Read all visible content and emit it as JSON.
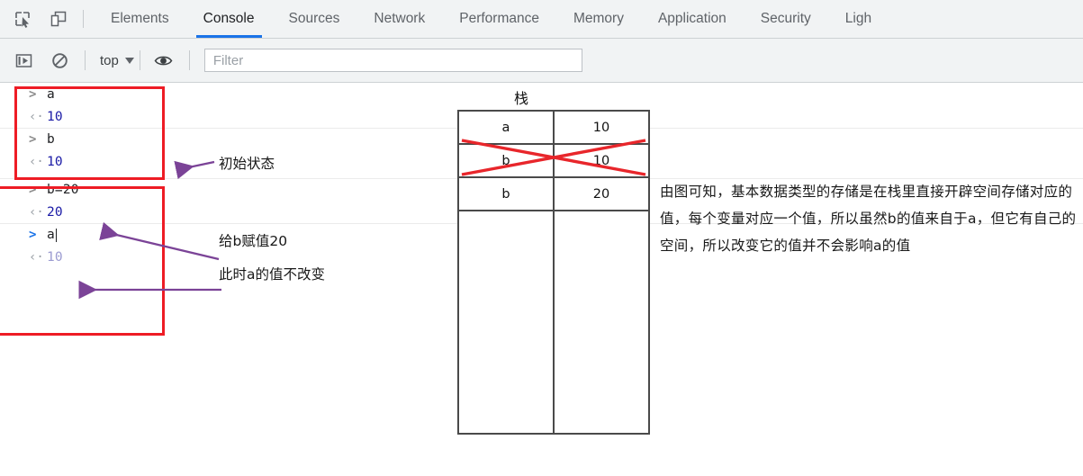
{
  "devtools": {
    "icons": [
      {
        "name": "inspect-element-icon",
        "label": "Inspect element"
      },
      {
        "name": "device-toolbar-icon",
        "label": "Toggle device toolbar"
      }
    ],
    "tabs": [
      {
        "label": "Elements",
        "active": false
      },
      {
        "label": "Console",
        "active": true
      },
      {
        "label": "Sources",
        "active": false
      },
      {
        "label": "Network",
        "active": false
      },
      {
        "label": "Performance",
        "active": false
      },
      {
        "label": "Memory",
        "active": false
      },
      {
        "label": "Application",
        "active": false
      },
      {
        "label": "Security",
        "active": false
      },
      {
        "label": "Ligh",
        "active": false
      }
    ],
    "active_tab": "Console",
    "accent_color": "#1a73e8",
    "toolbar_bg": "#f1f3f4"
  },
  "console_toolbar": {
    "execute_icon": "execute-step-icon",
    "clear_icon": "clear-console-icon",
    "context_label": "top",
    "context_caret": "caret-down-icon",
    "eye_icon": "live-expression-eye-icon",
    "filter_placeholder": "Filter"
  },
  "console": {
    "input_marker": ">",
    "output_marker": "‹·",
    "rows": [
      {
        "type": "input",
        "text": "a",
        "active": false
      },
      {
        "type": "output",
        "text": "10",
        "faded": false
      },
      {
        "type": "input",
        "text": "b",
        "active": false
      },
      {
        "type": "output",
        "text": "10",
        "faded": false
      },
      {
        "type": "input",
        "text": "b=20",
        "active": false
      },
      {
        "type": "output",
        "text": "20",
        "faded": false
      },
      {
        "type": "input",
        "text": "a",
        "active": true
      },
      {
        "type": "output",
        "text": "10",
        "faded": true
      }
    ],
    "value_color": "#1a1aa6",
    "faded_value_color": "#9b9bd1"
  },
  "annotations": {
    "box_color": "#ee1c25",
    "arrow_color": "#7b4397",
    "initial_state": "初始状态",
    "assign_b": "给b赋值20",
    "a_unchanged": "此时a的值不改变"
  },
  "stack_diagram": {
    "title": "栈",
    "cross_out_color": "#e8262b",
    "rows": [
      {
        "name": "a",
        "value": "10",
        "crossed": false
      },
      {
        "name": "b",
        "value": "10",
        "crossed": true
      },
      {
        "name": "b",
        "value": "20",
        "crossed": false
      }
    ]
  },
  "explanation": {
    "text": "由图可知，基本数据类型的存储是在栈里直接开辟空间存储对应的值，每个变量对应一个值，所以虽然b的值来自于a，但它有自己的空间，所以改变它的值并不会影响a的值"
  }
}
